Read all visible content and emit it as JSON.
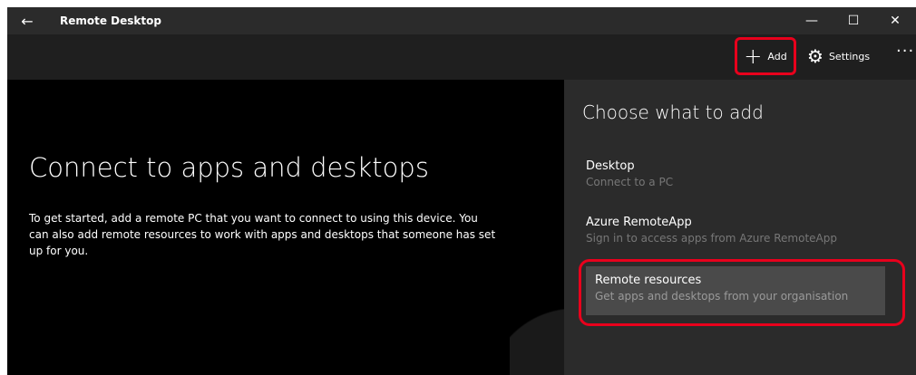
{
  "titlebar": {
    "back_icon": "back-arrow-icon",
    "title": "Remote Desktop",
    "minimize_glyph": "—",
    "maximize_glyph": "☐",
    "close_glyph": "✕"
  },
  "commandbar": {
    "add_label": "Add",
    "settings_label": "Settings",
    "more_glyph": "···"
  },
  "main": {
    "title": "Connect to apps and desktops",
    "description": "To get started, add a remote PC that you want to connect to using this device. You can also add remote resources to work with apps and desktops that someone has set up for you."
  },
  "flyout": {
    "title": "Choose what to add",
    "options": [
      {
        "title": "Desktop",
        "subtitle": "Connect to a PC"
      },
      {
        "title": "Azure RemoteApp",
        "subtitle": "Sign in to access apps from Azure RemoteApp"
      },
      {
        "title": "Remote resources",
        "subtitle": "Get apps and desktops from your organisation"
      }
    ]
  },
  "colors": {
    "highlight": "#e8001c",
    "titlebar_bg": "#2b2b2b",
    "flyout_bg": "#2b2b2b",
    "selected_bg": "#4a4a4a"
  }
}
